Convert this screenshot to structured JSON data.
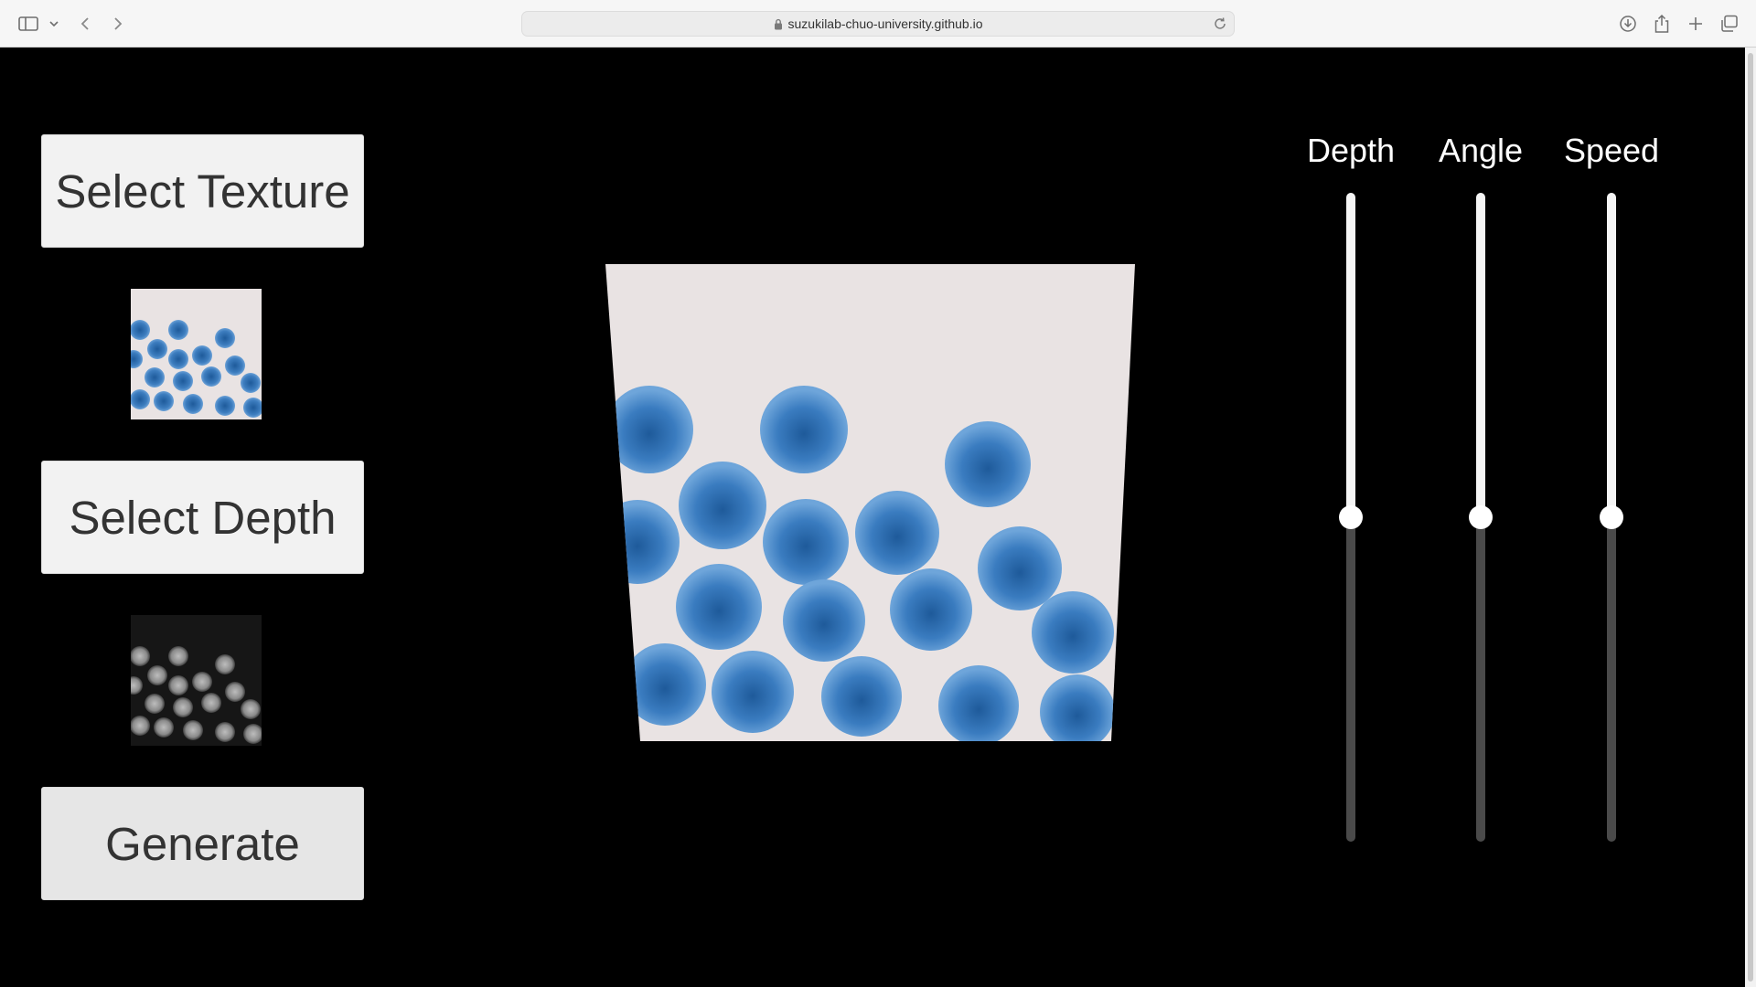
{
  "browser": {
    "url": "suzukilab-chuo-university.github.io"
  },
  "buttons": {
    "select_texture": "Select Texture",
    "select_depth": "Select Depth",
    "generate": "Generate"
  },
  "sliders": [
    {
      "label": "Depth",
      "value": 0.5
    },
    {
      "label": "Angle",
      "value": 0.5
    },
    {
      "label": "Speed",
      "value": 0.5
    }
  ],
  "colors": {
    "ball": "#3d7dbf",
    "ball_dark": "#1e5a9a",
    "canvas_bg": "#e9e3e3",
    "depth_bg": "#161616"
  }
}
